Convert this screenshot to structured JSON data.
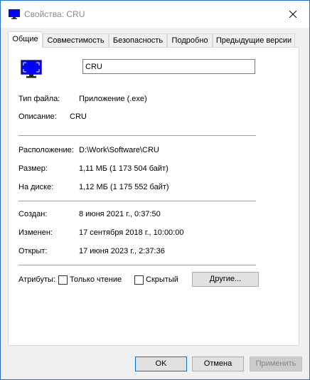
{
  "window": {
    "title": "Свойства: CRU",
    "app_icon": "monitor-icon",
    "close_icon": "close-icon"
  },
  "tabs": [
    {
      "label": "Общие",
      "active": true
    },
    {
      "label": "Совместимость",
      "active": false
    },
    {
      "label": "Безопасность",
      "active": false
    },
    {
      "label": "Подробно",
      "active": false
    },
    {
      "label": "Предыдущие версии",
      "active": false
    }
  ],
  "general": {
    "file_name": "CRU",
    "file_type_label": "Тип файла:",
    "file_type_value": "Приложение (.exe)",
    "description_label": "Описание:",
    "description_value": "CRU",
    "location_label": "Расположение:",
    "location_value": "D:\\Work\\Software\\CRU",
    "size_label": "Размер:",
    "size_value": "1,11 МБ (1 173 504 байт)",
    "disk_size_label": "На диске:",
    "disk_size_value": "1,12 МБ (1 175 552 байт)",
    "created_label": "Создан:",
    "created_value": "8 июня 2021 г., 0:37:50",
    "modified_label": "Изменен:",
    "modified_value": "17 сентября 2018 г., 10:00:00",
    "accessed_label": "Открыт:",
    "accessed_value": "17 июня 2023 г., 2:37:36",
    "attributes_label": "Атрибуты:",
    "readonly_label": "Только чтение",
    "readonly_checked": false,
    "hidden_label": "Скрытый",
    "hidden_checked": false,
    "advanced_button": "Другие..."
  },
  "footer": {
    "ok": "OK",
    "cancel": "Отмена",
    "apply": "Применить"
  },
  "colors": {
    "accent": "#0078d7",
    "icon_blue": "#0000ff"
  }
}
